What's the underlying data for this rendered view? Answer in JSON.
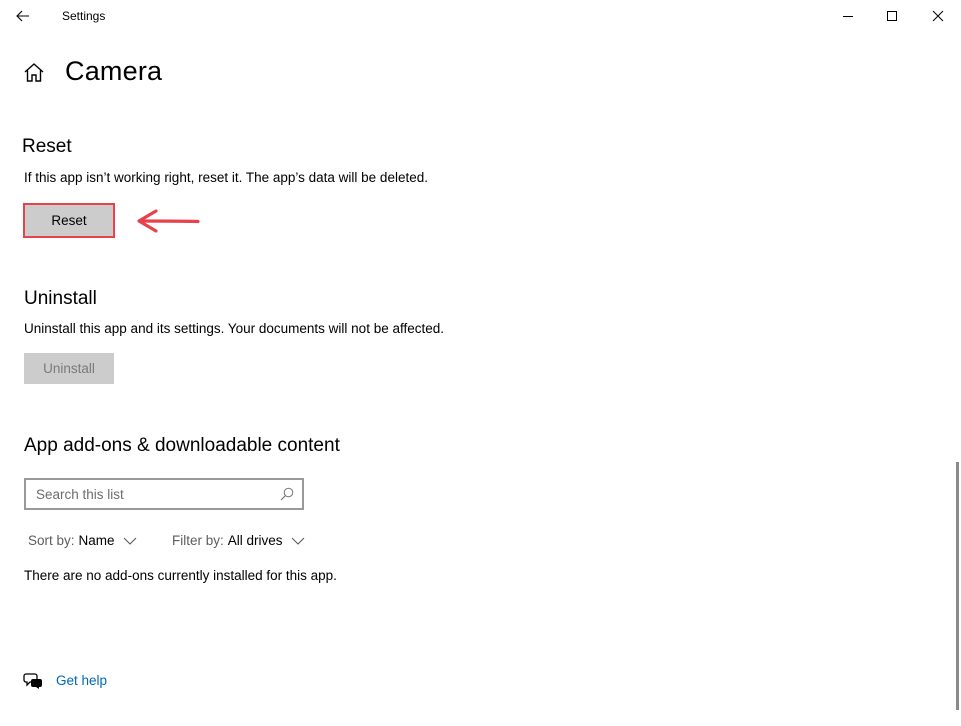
{
  "window": {
    "title": "Settings",
    "icons": {
      "back": "back-arrow-icon",
      "minimize": "minimize-icon",
      "maximize": "maximize-icon",
      "close": "close-icon"
    }
  },
  "page": {
    "title": "Camera",
    "home_icon": "home-icon"
  },
  "reset": {
    "heading": "Reset",
    "description": "If this app isn’t working right, reset it. The app’s data will be deleted.",
    "button_label": "Reset",
    "highlight_color": "#e8414b"
  },
  "uninstall": {
    "heading": "Uninstall",
    "description": "Uninstall this app and its settings. Your documents will not be affected.",
    "button_label": "Uninstall",
    "button_state": "disabled"
  },
  "addons": {
    "heading": "App add-ons & downloadable content",
    "search_placeholder": "Search this list",
    "sort": {
      "label": "Sort by:",
      "value": "Name"
    },
    "filter": {
      "label": "Filter by:",
      "value": "All drives"
    },
    "empty_message": "There are no add-ons currently installed for this app."
  },
  "help": {
    "label": "Get help",
    "icon": "chat-help-icon"
  },
  "colors": {
    "link": "#0067b8",
    "button_bg": "#cccccc",
    "annotation": "#e8414b"
  }
}
